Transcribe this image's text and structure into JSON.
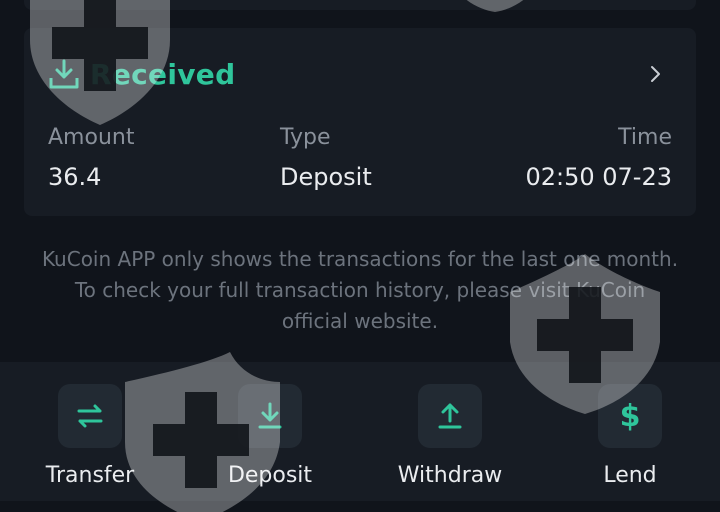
{
  "card": {
    "status": "Received",
    "status_icon": "download-tray-icon",
    "chevron_icon": "chevron-right-icon",
    "columns": [
      {
        "label": "Amount",
        "value": "36.4"
      },
      {
        "label": "Type",
        "value": "Deposit"
      },
      {
        "label": "Time",
        "value": "02:50 07-23"
      }
    ]
  },
  "notice": "KuCoin APP only shows the transactions for the last one month. To check your full transaction history, please visit KuCoin official website.",
  "actions": [
    {
      "label": "Transfer",
      "icon": "transfer-arrows-icon"
    },
    {
      "label": "Deposit",
      "icon": "deposit-download-icon"
    },
    {
      "label": "Withdraw",
      "icon": "withdraw-upload-icon"
    },
    {
      "label": "Lend",
      "icon": "dollar-icon"
    }
  ],
  "colors": {
    "accent": "#2fc59b",
    "background": "#10141b",
    "card": "#171c24",
    "muted_text": "#6c737d"
  }
}
